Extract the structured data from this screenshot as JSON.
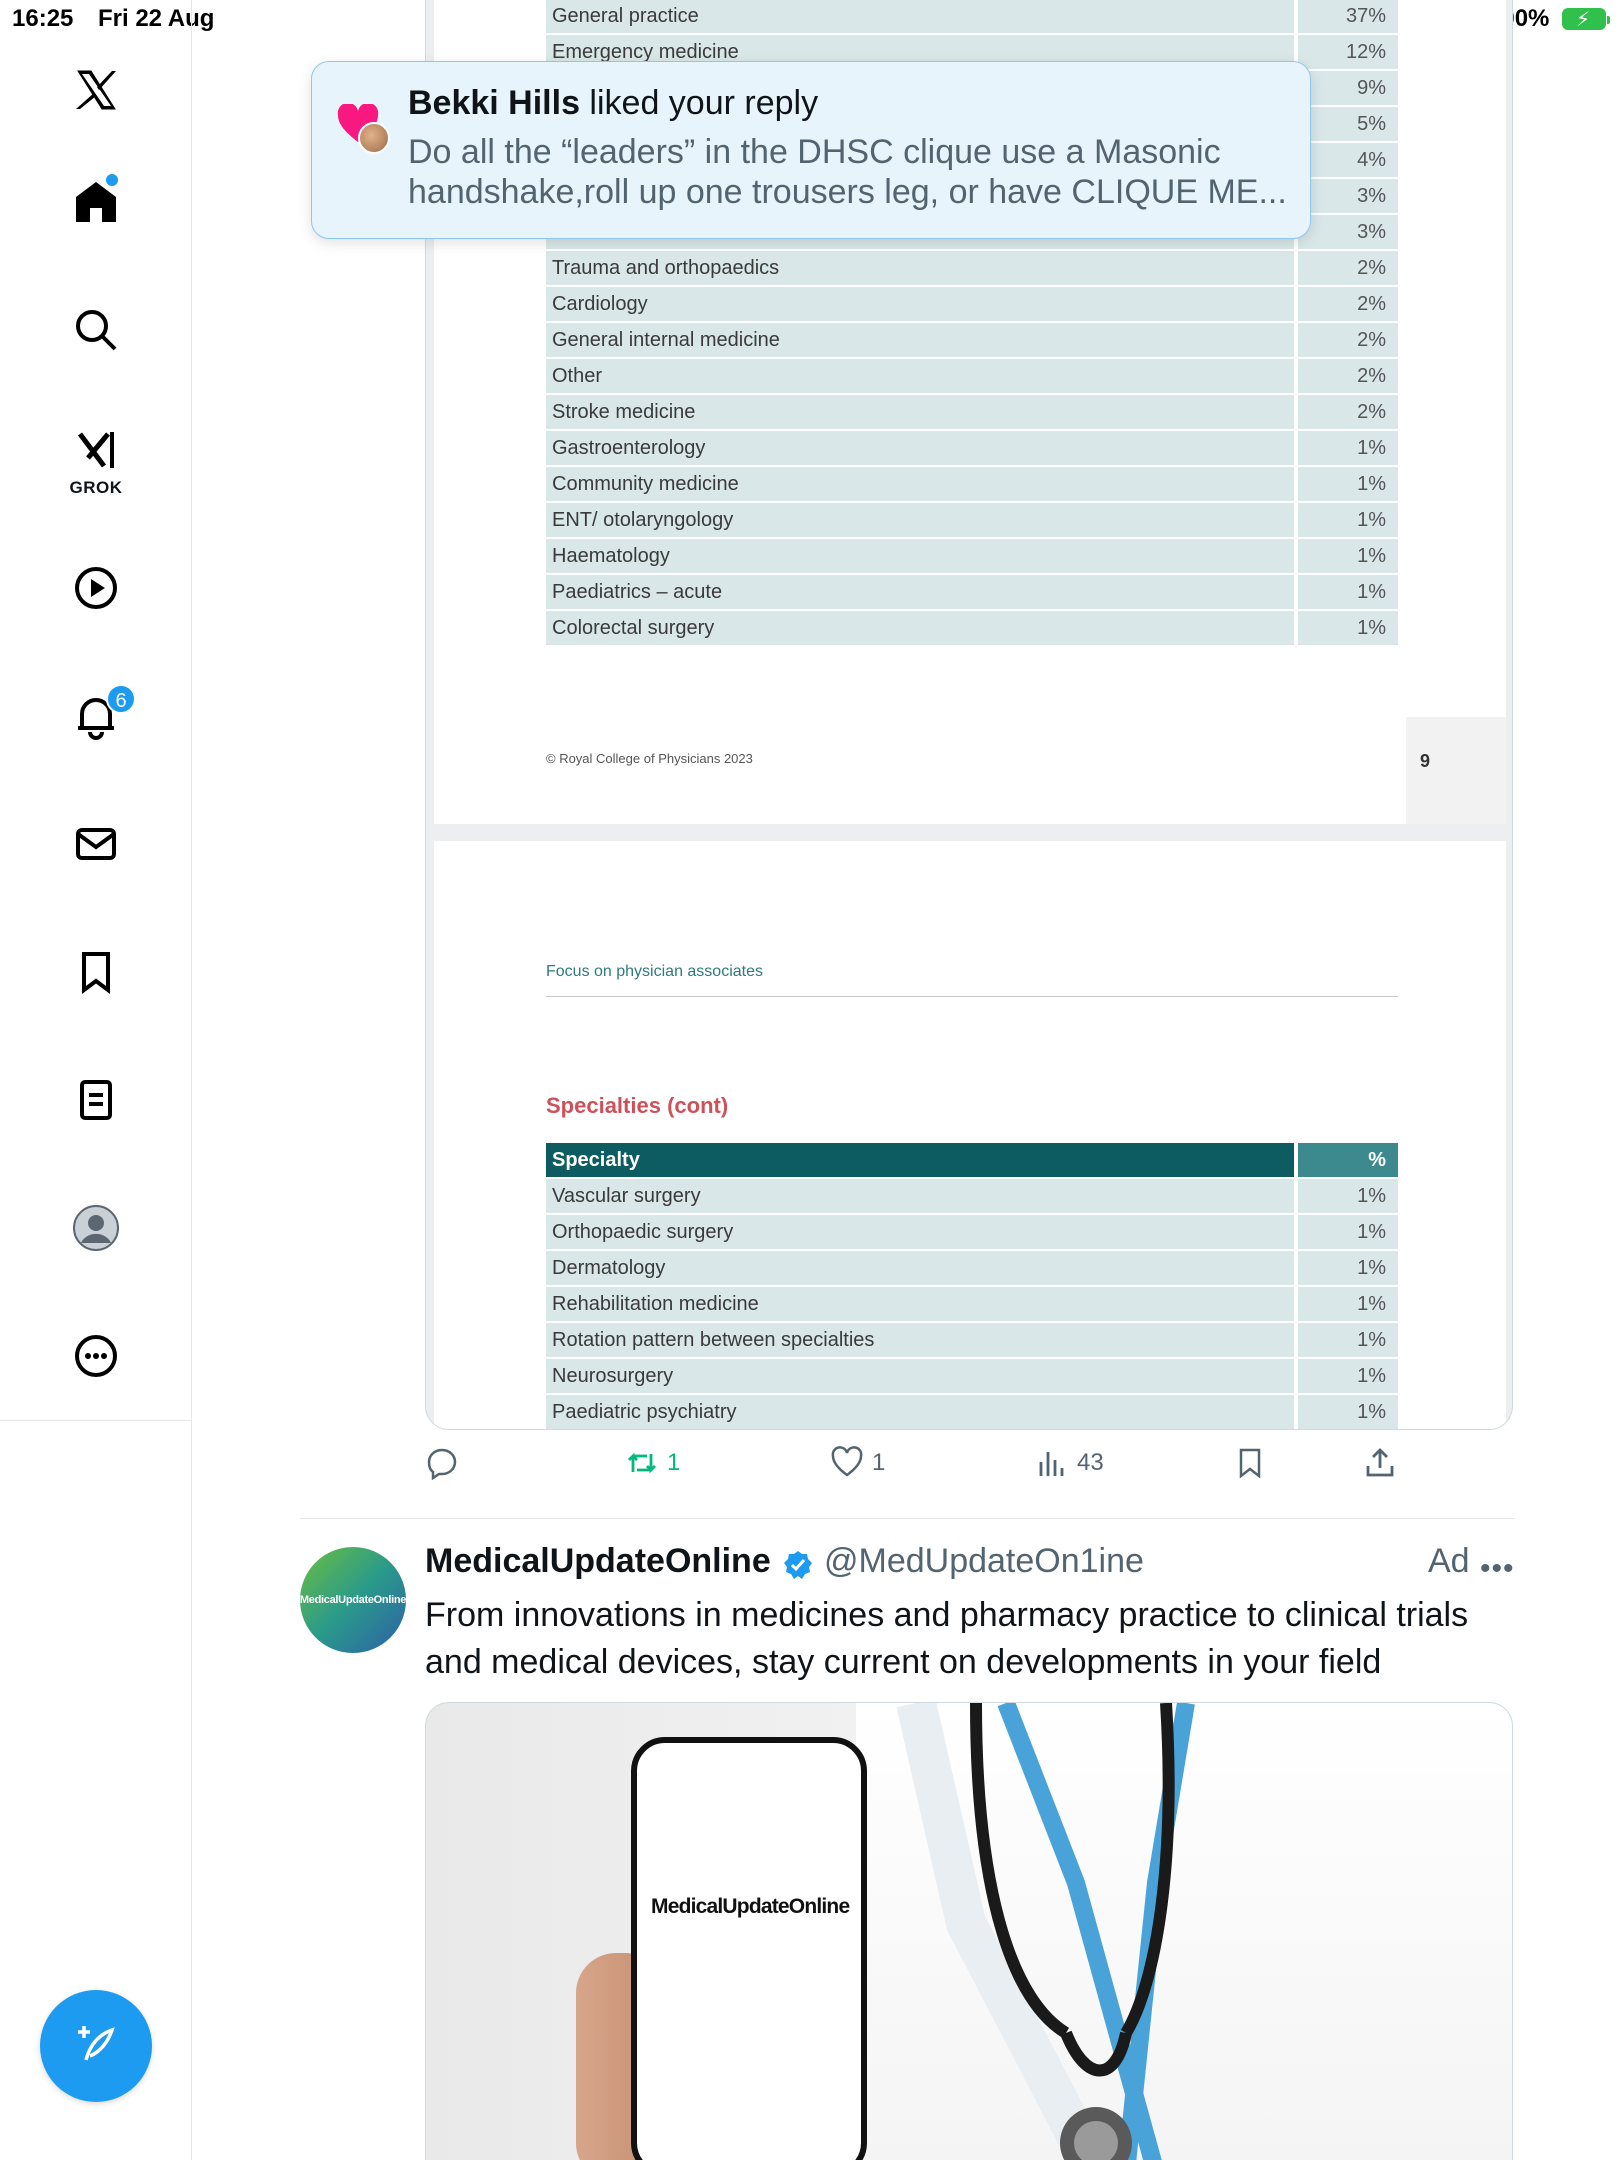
{
  "status_bar": {
    "time": "16:25",
    "date": "Fri 22 Aug",
    "battery_pct": "100%"
  },
  "sidebar": {
    "grok_label": "GROK",
    "notification_count": "6"
  },
  "toast": {
    "user": "Bekki Hills",
    "action": " liked your reply",
    "message": "Do all the “leaders” in the DHSC clique use a Masonic handshake,roll up one trousers leg, or have CLIQUE ME..."
  },
  "document": {
    "page1_rows": [
      {
        "name": "General practice",
        "pct": "37%"
      },
      {
        "name": "Emergency medicine",
        "pct": "12%"
      },
      {
        "name": "",
        "pct": "9%"
      },
      {
        "name": "",
        "pct": "5%"
      },
      {
        "name": "",
        "pct": "4%"
      },
      {
        "name": "",
        "pct": "3%"
      },
      {
        "name": "",
        "pct": "3%"
      },
      {
        "name": "Trauma and orthopaedics",
        "pct": "2%"
      },
      {
        "name": "Cardiology",
        "pct": "2%"
      },
      {
        "name": "General internal medicine",
        "pct": "2%"
      },
      {
        "name": "Other",
        "pct": "2%"
      },
      {
        "name": "Stroke medicine",
        "pct": "2%"
      },
      {
        "name": "Gastroenterology",
        "pct": "1%"
      },
      {
        "name": "Community medicine",
        "pct": "1%"
      },
      {
        "name": "ENT/ otolaryngology",
        "pct": "1%"
      },
      {
        "name": "Haematology",
        "pct": "1%"
      },
      {
        "name": "Paediatrics – acute",
        "pct": "1%"
      },
      {
        "name": "Colorectal surgery",
        "pct": "1%"
      }
    ],
    "copyright": "© Royal College of Physicians 2023",
    "page_number": "9",
    "section_title": "Focus on physician associates",
    "table_title": "Specialties (cont)",
    "header": {
      "name": "Specialty",
      "pct": "%"
    },
    "page2_rows": [
      {
        "name": "Vascular surgery",
        "pct": "1%"
      },
      {
        "name": "Orthopaedic surgery",
        "pct": "1%"
      },
      {
        "name": "Dermatology",
        "pct": "1%"
      },
      {
        "name": "Rehabilitation medicine",
        "pct": "1%"
      },
      {
        "name": "Rotation pattern between specialties",
        "pct": "1%"
      },
      {
        "name": "Neurosurgery",
        "pct": "1%"
      },
      {
        "name": "Paediatric psychiatry",
        "pct": "1%"
      }
    ]
  },
  "tweet_actions": {
    "retweets": "1",
    "likes": "1",
    "views": "43"
  },
  "ad": {
    "name": "MedicalUpdateOnline",
    "handle": "@MedUpdateOn1ine",
    "label": "Ad",
    "text": "From innovations in medicines and pharmacy practice to clinical trials and medical devices, stay current on developments in your field",
    "avatar_text": "MedicalUpdateOnline",
    "phone_text": "MedicalUpdateOnline"
  },
  "colors": {
    "accent": "#1d9bf0",
    "retweet": "#00ba7c",
    "table_header": "#0c5c62",
    "table_row": "#d9e7e8",
    "heading_red": "#d0505a"
  },
  "icons": [
    "x-logo-icon",
    "home-icon",
    "search-icon",
    "grok-icon",
    "video-icon",
    "bell-icon",
    "mail-icon",
    "bookmark-icon",
    "list-icon",
    "profile-icon",
    "more-icon",
    "compose-icon"
  ]
}
